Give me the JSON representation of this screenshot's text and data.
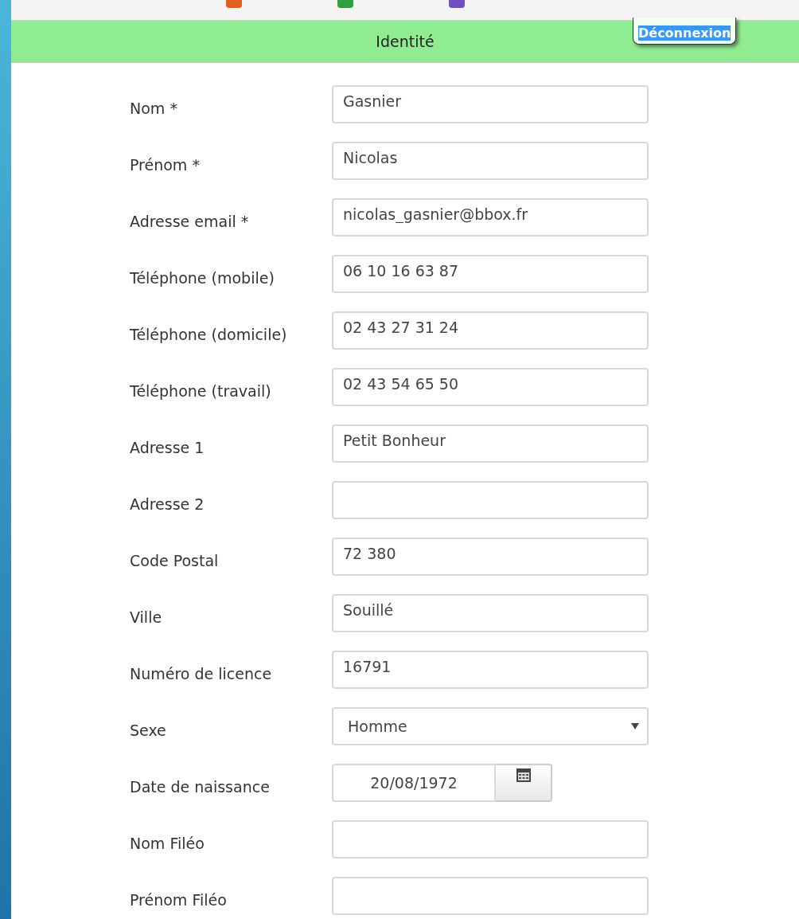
{
  "header": {
    "title": "Identité",
    "logout_button": "Déconnexion"
  },
  "fields": [
    {
      "kind": "text",
      "label": "Nom *",
      "value": "Gasnier"
    },
    {
      "kind": "text",
      "label": "Prénom *",
      "value": "Nicolas"
    },
    {
      "kind": "text",
      "label": "Adresse email *",
      "value": "nicolas_gasnier@bbox.fr"
    },
    {
      "kind": "text",
      "label": "Téléphone (mobile)",
      "value": "06 10 16 63 87"
    },
    {
      "kind": "text",
      "label": "Téléphone (domicile)",
      "value": "02 43 27 31 24"
    },
    {
      "kind": "text",
      "label": "Téléphone (travail)",
      "value": "02 43 54 65 50"
    },
    {
      "kind": "text",
      "label": "Adresse 1",
      "value": "Petit Bonheur"
    },
    {
      "kind": "text",
      "label": "Adresse 2"
    },
    {
      "kind": "text",
      "label": "Code Postal",
      "value": "72 380"
    },
    {
      "kind": "text",
      "label": "Ville",
      "value": "Souillé"
    },
    {
      "kind": "text",
      "label": "Numéro de licence",
      "value": "16791"
    },
    {
      "kind": "select",
      "label": "Sexe",
      "value": "Homme"
    },
    {
      "kind": "date",
      "label": "Date de naissance",
      "value": "20/08/1972"
    },
    {
      "kind": "text",
      "label": "Nom Filéo"
    },
    {
      "kind": "text",
      "label": "Prénom Filéo"
    }
  ]
}
